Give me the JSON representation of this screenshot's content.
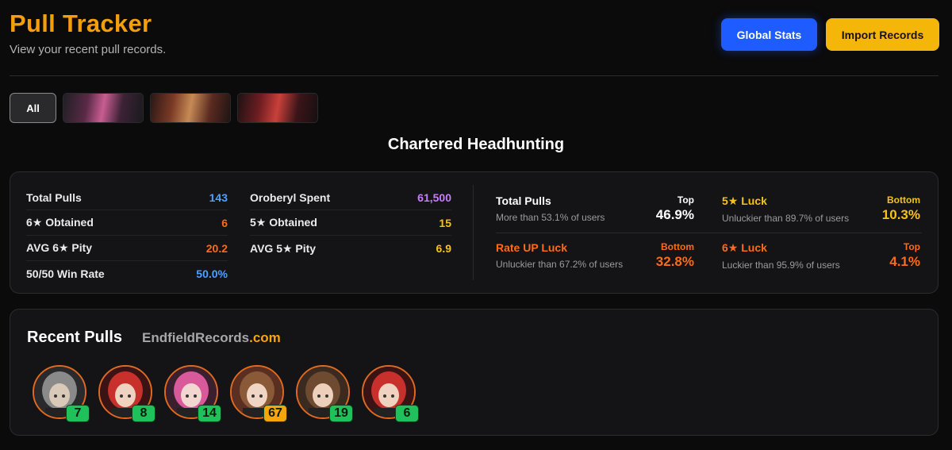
{
  "header": {
    "title": "Pull Tracker",
    "subtitle": "View your recent pull records.",
    "global_stats_label": "Global Stats",
    "import_label": "Import Records"
  },
  "filters": {
    "all_label": "All",
    "banners": [
      "pink-haired operator banner",
      "brown-haired operator banner",
      "red-haired operator banner"
    ]
  },
  "section_title": "Chartered Headhunting",
  "stats": {
    "left": [
      {
        "label": "Total Pulls",
        "value": "143",
        "color": "#4ea0ff"
      },
      {
        "label": "6★ Obtained",
        "value": "6",
        "color": "#ff6a1a"
      },
      {
        "label": "AVG 6★ Pity",
        "value": "20.2",
        "color": "#ff6a1a"
      },
      {
        "label": "50/50 Win Rate",
        "value": "50.0%",
        "color": "#4ea0ff"
      }
    ],
    "right": [
      {
        "label": "Oroberyl Spent",
        "value": "61,500",
        "color": "#c77dff"
      },
      {
        "label": "5★ Obtained",
        "value": "15",
        "color": "#f5c21a"
      },
      {
        "label": "AVG 5★ Pity",
        "value": "6.9",
        "color": "#f5c21a"
      }
    ]
  },
  "luck": [
    {
      "title": "Total Pulls",
      "title_color": "#ffffff",
      "sub": "More than 53.1% of users",
      "rank": "Top",
      "rank_color": "#ffffff",
      "pct": "46.9%",
      "pct_color": "#ffffff"
    },
    {
      "title": "5★ Luck",
      "title_color": "#f5c21a",
      "sub": "Unluckier than 89.7% of users",
      "rank": "Bottom",
      "rank_color": "#f5c21a",
      "pct": "10.3%",
      "pct_color": "#f5c21a"
    },
    {
      "title": "Rate UP Luck",
      "title_color": "#ff6a1a",
      "sub": "Unluckier than 67.2% of users",
      "rank": "Bottom",
      "rank_color": "#ff6a1a",
      "pct": "32.8%",
      "pct_color": "#ff6a1a"
    },
    {
      "title": "6★ Luck",
      "title_color": "#ff6a1a",
      "sub": "Luckier than 95.9% of users",
      "rank": "Top",
      "rank_color": "#ff6a1a",
      "pct": "4.1%",
      "pct_color": "#ff6a1a"
    }
  ],
  "recent": {
    "title": "Recent Pulls",
    "brand_name": "EndfieldRecords",
    "brand_domain": ".com",
    "pulls": [
      {
        "pity": "7",
        "badge_color": "#1fc25a",
        "hair": "#8a8a8a",
        "skin": "#d9c9b8",
        "bg": "#2a2a2c"
      },
      {
        "pity": "8",
        "badge_color": "#1fc25a",
        "hair": "#c8302c",
        "skin": "#f0d2c0",
        "bg": "#3a1414"
      },
      {
        "pity": "14",
        "badge_color": "#1fc25a",
        "hair": "#d85a9a",
        "skin": "#f2d6d0",
        "bg": "#3a1f2e"
      },
      {
        "pity": "67",
        "badge_color": "#f5a60a",
        "hair": "#8a5a38",
        "skin": "#f0d4c4",
        "bg": "#5a2f22"
      },
      {
        "pity": "19",
        "badge_color": "#1fc25a",
        "hair": "#6e4a30",
        "skin": "#ecd0bc",
        "bg": "#3a2a20"
      },
      {
        "pity": "6",
        "badge_color": "#1fc25a",
        "hair": "#c8302c",
        "skin": "#f0d2c0",
        "bg": "#3a1414"
      }
    ]
  }
}
